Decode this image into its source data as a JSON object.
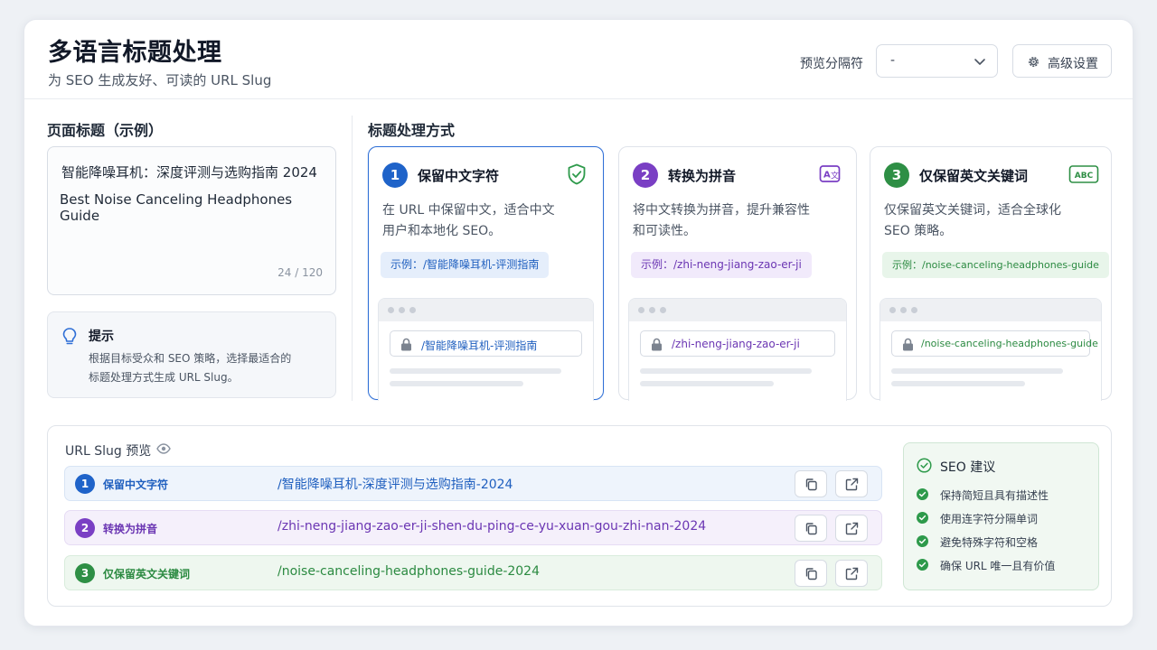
{
  "header": {
    "title": "多语言标题处理",
    "subtitle": "为 SEO 生成友好、可读的 URL Slug",
    "separator_label": "预览分隔符",
    "separator_value": "-",
    "advanced_label": "高级设置"
  },
  "page_title": {
    "label": "页面标题（示例）",
    "line1": "智能降噪耳机：深度评测与选购指南 2024",
    "line2": "Best Noise Canceling Headphones Guide",
    "count": "24 / 120"
  },
  "tip": {
    "title": "提示",
    "line1": "根据目标受众和 SEO 策略，选择最适合的",
    "line2": "标题处理方式生成 URL Slug。"
  },
  "methods_label": "标题处理方式",
  "methods": [
    {
      "num": "1",
      "title": "保留中文字符",
      "desc1": "在 URL 中保留中文，适合中文",
      "desc2": "用户和本地化 SEO。",
      "example": "示例：/智能降噪耳机-评测指南",
      "url": "/智能降噪耳机-评测指南",
      "icon": "shield-check-icon",
      "color": "#1f63c9"
    },
    {
      "num": "2",
      "title": "转换为拼音",
      "desc1": "将中文转换为拼音，提升兼容性",
      "desc2": "和可读性。",
      "example": "示例：/zhi-neng-jiang-zao-er-ji",
      "url": "/zhi-neng-jiang-zao-er-ji",
      "icon": "translate-icon",
      "color": "#7a3fc4"
    },
    {
      "num": "3",
      "title": "仅保留英文关键词",
      "desc1": "仅保留英文关键词，适合全球化",
      "desc2": "SEO 策略。",
      "example": "示例：/noise-canceling-headphones-guide",
      "url": "/noise-canceling-headphones-guide",
      "icon": "abc-icon",
      "color": "#2e8f45"
    }
  ],
  "preview": {
    "title": "URL Slug 预览",
    "rows": [
      {
        "num": "1",
        "label": "保留中文字符",
        "slug": "/智能降噪耳机-深度评测与选购指南-2024"
      },
      {
        "num": "2",
        "label": "转换为拼音",
        "slug": "/zhi-neng-jiang-zao-er-ji-shen-du-ping-ce-yu-xuan-gou-zhi-nan-2024"
      },
      {
        "num": "3",
        "label": "仅保留英文关键词",
        "slug": "/noise-canceling-headphones-guide-2024"
      }
    ]
  },
  "seo": {
    "title": "SEO 建议",
    "items": [
      "保持简短且具有描述性",
      "使用连字符分隔单词",
      "避免特殊字符和空格",
      "确保 URL 唯一且有价值"
    ]
  }
}
